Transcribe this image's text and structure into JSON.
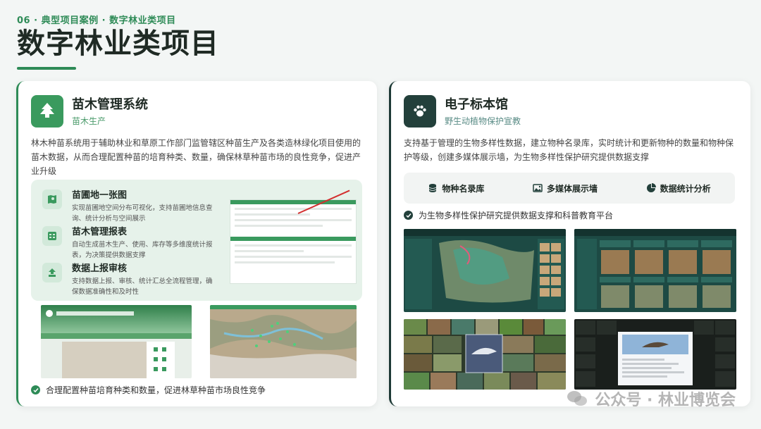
{
  "header": {
    "section_tag": "06 · 典型项目案例 · 数字林业类项目",
    "title": "数字林业类项目"
  },
  "left_card": {
    "icon": "tree-icon",
    "title": "苗木管理系统",
    "subtitle": "苗木生产",
    "description": "林木种苗系统用于辅助林业和草原工作部门监管辖区种苗生产及各类造林绿化项目使用的苗木数据，从而合理配置种苗的培育种类、数量，确保林草种苗市场的良性竞争，促进产业升级",
    "features": [
      {
        "icon": "map-pin-icon",
        "title": "苗圃地一张图",
        "desc": "实现苗圃地空间分布可视化，支持苗圃地信息查询、统计分析与空间展示"
      },
      {
        "icon": "table-icon",
        "title": "苗木管理报表",
        "desc": "自动生成苗木生产、使用、库存等多维度统计报表，为决策提供数据支撑"
      },
      {
        "icon": "upload-icon",
        "title": "数据上报审核",
        "desc": "支持数据上报、审核、统计汇总全流程管理，确保数据准确性和及时性"
      }
    ],
    "note": "合理配置种苗培育种类和数量，促进林草种苗市场良性竞争"
  },
  "right_card": {
    "icon": "paw-icon",
    "title": "电子标本馆",
    "subtitle": "野生动植物保护宣教",
    "description": "支持基于管理的生物多样性数据，建立物种名录库，实时统计和更新物种的数量和物种保护等级，创建多媒体展示墙，为生物多样性保护研究提供数据支撑",
    "tabs": [
      {
        "icon": "database-icon",
        "label": "物种名录库"
      },
      {
        "icon": "image-icon",
        "label": "多媒体展示墙"
      },
      {
        "icon": "pie-chart-icon",
        "label": "数据统计分析"
      }
    ],
    "note": "为生物多样性保护研究提供数据支撑和科普教育平台"
  },
  "watermark": {
    "text": "公众号 · 林业博览会"
  },
  "colors": {
    "accent_green": "#2e8b57",
    "dark_teal": "#23403b"
  }
}
